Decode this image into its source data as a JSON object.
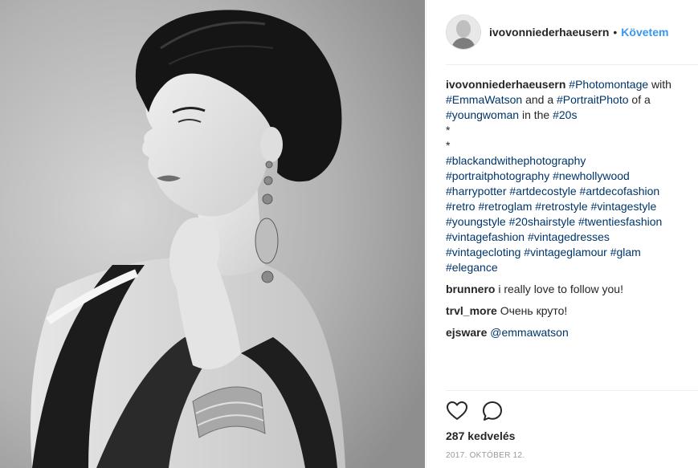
{
  "header": {
    "username": "ivovonniederhaeusern",
    "separator": "•",
    "follow_label": "Követem"
  },
  "caption": {
    "username": "ivovonniederhaeusern",
    "parts": [
      {
        "type": "tag",
        "text": "#Photomontage"
      },
      {
        "type": "text",
        "text": " with "
      },
      {
        "type": "tag",
        "text": "#EmmaWatson"
      },
      {
        "type": "text",
        "text": " and a "
      },
      {
        "type": "tag",
        "text": "#PortraitPhoto"
      },
      {
        "type": "text",
        "text": " of a "
      },
      {
        "type": "tag",
        "text": "#youngwoman"
      },
      {
        "type": "text",
        "text": " in the "
      },
      {
        "type": "tag",
        "text": "#20s"
      },
      {
        "type": "br"
      },
      {
        "type": "text",
        "text": "*"
      },
      {
        "type": "br"
      },
      {
        "type": "text",
        "text": "*"
      },
      {
        "type": "br"
      },
      {
        "type": "tag",
        "text": "#blackandwithephotography"
      },
      {
        "type": "br"
      },
      {
        "type": "tag",
        "text": "#portraitphotography"
      },
      {
        "type": "text",
        "text": " "
      },
      {
        "type": "tag",
        "text": "#newhollywood"
      },
      {
        "type": "text",
        "text": " "
      },
      {
        "type": "tag",
        "text": "#harrypotter"
      },
      {
        "type": "text",
        "text": " "
      },
      {
        "type": "tag",
        "text": "#artdecostyle"
      },
      {
        "type": "text",
        "text": " "
      },
      {
        "type": "tag",
        "text": "#artdecofashion"
      },
      {
        "type": "text",
        "text": " "
      },
      {
        "type": "tag",
        "text": "#retro"
      },
      {
        "type": "text",
        "text": " "
      },
      {
        "type": "tag",
        "text": "#retroglam"
      },
      {
        "type": "text",
        "text": " "
      },
      {
        "type": "tag",
        "text": "#retrostyle"
      },
      {
        "type": "text",
        "text": " "
      },
      {
        "type": "tag",
        "text": "#vintagestyle"
      },
      {
        "type": "text",
        "text": " "
      },
      {
        "type": "tag",
        "text": "#youngstyle"
      },
      {
        "type": "text",
        "text": " "
      },
      {
        "type": "tag",
        "text": "#20shairstyle"
      },
      {
        "type": "text",
        "text": " "
      },
      {
        "type": "tag",
        "text": "#twentiesfashion"
      },
      {
        "type": "text",
        "text": " "
      },
      {
        "type": "tag",
        "text": "#vintagefashion"
      },
      {
        "type": "text",
        "text": " "
      },
      {
        "type": "tag",
        "text": "#vintagedresses"
      },
      {
        "type": "text",
        "text": " "
      },
      {
        "type": "tag",
        "text": "#vintagecloting"
      },
      {
        "type": "text",
        "text": " "
      },
      {
        "type": "tag",
        "text": "#vintageglamour"
      },
      {
        "type": "text",
        "text": " "
      },
      {
        "type": "tag",
        "text": "#glam"
      },
      {
        "type": "text",
        "text": " "
      },
      {
        "type": "tag",
        "text": "#elegance"
      }
    ]
  },
  "comments": [
    {
      "username": "brunnero",
      "text": "i really love to follow you!",
      "is_mention": false
    },
    {
      "username": "trvl_more",
      "text": "Очень круто!",
      "is_mention": false
    },
    {
      "username": "ejsware",
      "text": "@emmawatson",
      "is_mention": true
    }
  ],
  "actions": {
    "like_icon": "heart-outline-icon",
    "comment_icon": "speech-bubble-icon"
  },
  "likes_label": "287 kedvelés",
  "date_label": "2017. OKTÓBER 12.",
  "colors": {
    "link": "#003569",
    "follow": "#3897f0",
    "text": "#262626",
    "muted": "#999999"
  }
}
